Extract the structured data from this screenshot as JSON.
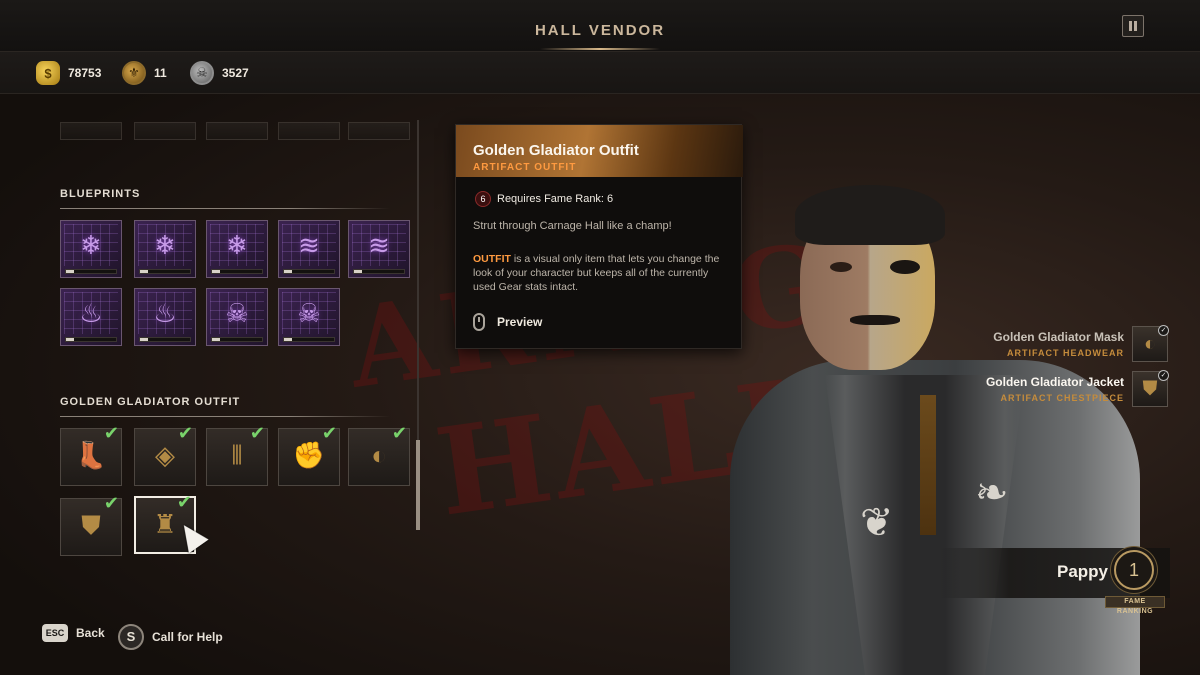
{
  "header": {
    "title": "HALL VENDOR"
  },
  "currencies": [
    {
      "icon": "gold-coins-icon",
      "value": "78753"
    },
    {
      "icon": "fame-token-icon",
      "value": "11"
    },
    {
      "icon": "skull-coin-icon",
      "value": "3527"
    }
  ],
  "sections": {
    "blueprints": {
      "title": "BLUEPRINTS"
    },
    "outfit": {
      "title": "GOLDEN GLADIATOR OUTFIT"
    }
  },
  "tooltip": {
    "name": "Golden Gladiator Outfit",
    "type": "ARTIFACT OUTFIT",
    "rank_value": "6",
    "requirement": "Requires Fame Rank: 6",
    "flavor": "Strut through Carnage Hall like a champ!",
    "desc_keyword": "OUTFIT",
    "desc_rest": " is a visual only item that lets you change the look of your character but keeps all of the currently used Gear stats intact.",
    "preview_label": "Preview"
  },
  "equipped": [
    {
      "name": "Golden Gladiator Mask",
      "type": "ARTIFACT HEADWEAR"
    },
    {
      "name": "Golden Gladiator Jacket",
      "type": "ARTIFACT CHESTPIECE"
    }
  ],
  "player": {
    "name": "Pappy",
    "fame_rank": "1",
    "fame_label": "FAME RANKING"
  },
  "footer": {
    "back_key": "ESC",
    "back_label": "Back",
    "help_key": "S",
    "help_label": "Call for Help"
  },
  "background_sign": {
    "line1": "ARNAG",
    "line2": "HALL"
  }
}
